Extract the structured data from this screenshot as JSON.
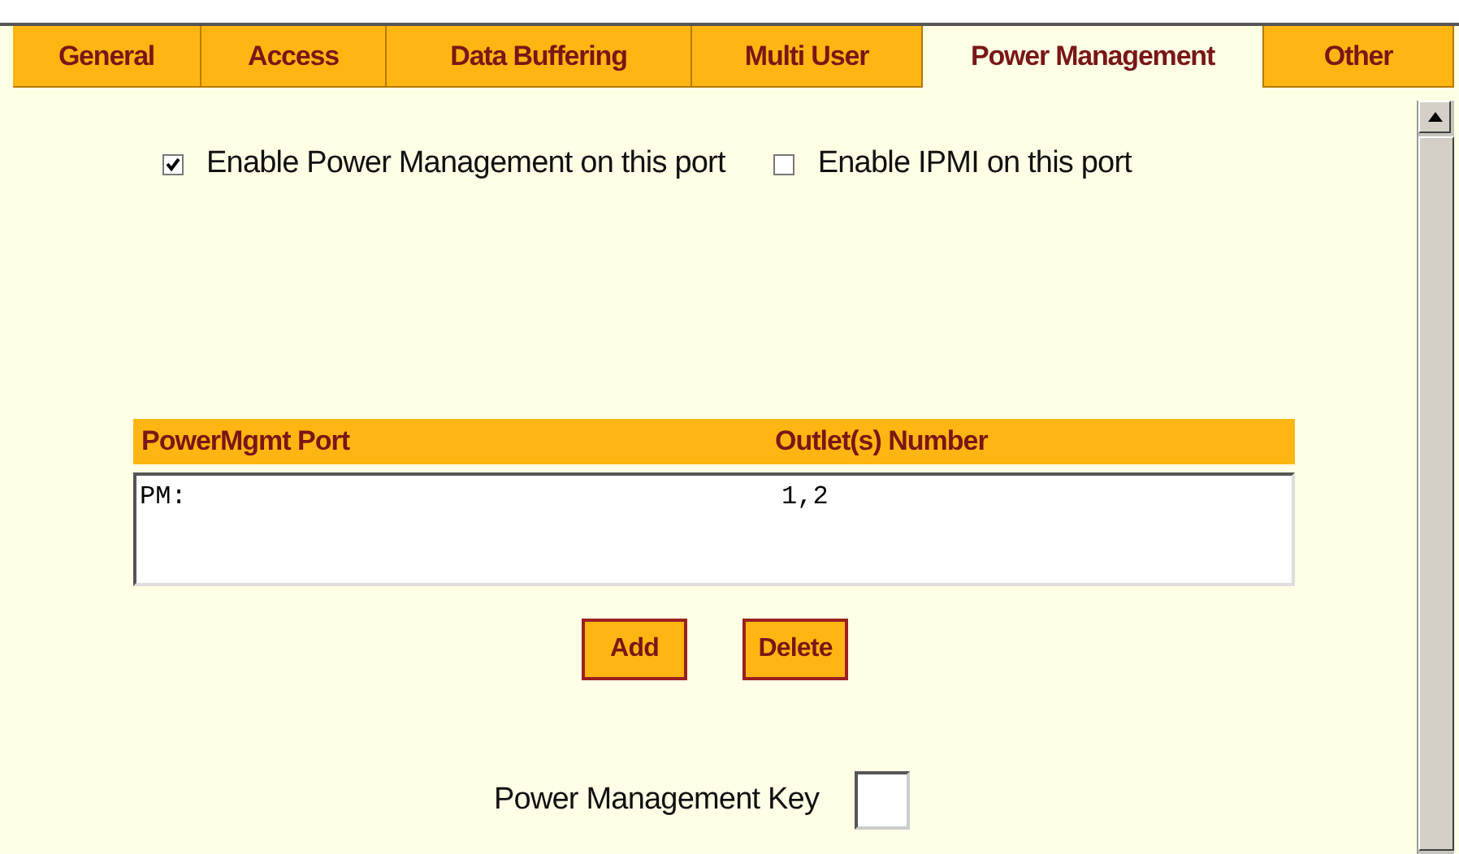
{
  "tabs": [
    {
      "label": "General",
      "selected": false
    },
    {
      "label": "Access",
      "selected": false
    },
    {
      "label": "Data Buffering",
      "selected": false
    },
    {
      "label": "Multi User",
      "selected": false
    },
    {
      "label": "Power Management",
      "selected": true
    },
    {
      "label": "Other",
      "selected": false
    }
  ],
  "options": [
    {
      "label": "Enable Power Management on this port",
      "checked": true
    },
    {
      "label": "Enable IPMI on this port",
      "checked": false
    }
  ],
  "table": {
    "columns": [
      "PowerMgmt Port",
      "Outlet(s) Number"
    ],
    "rows": [
      {
        "port": "PM:",
        "outlets": "1,2",
        "selected": false
      }
    ]
  },
  "buttons": [
    "Add",
    "Delete"
  ],
  "key_field": {
    "label": "Power Management Key"
  }
}
